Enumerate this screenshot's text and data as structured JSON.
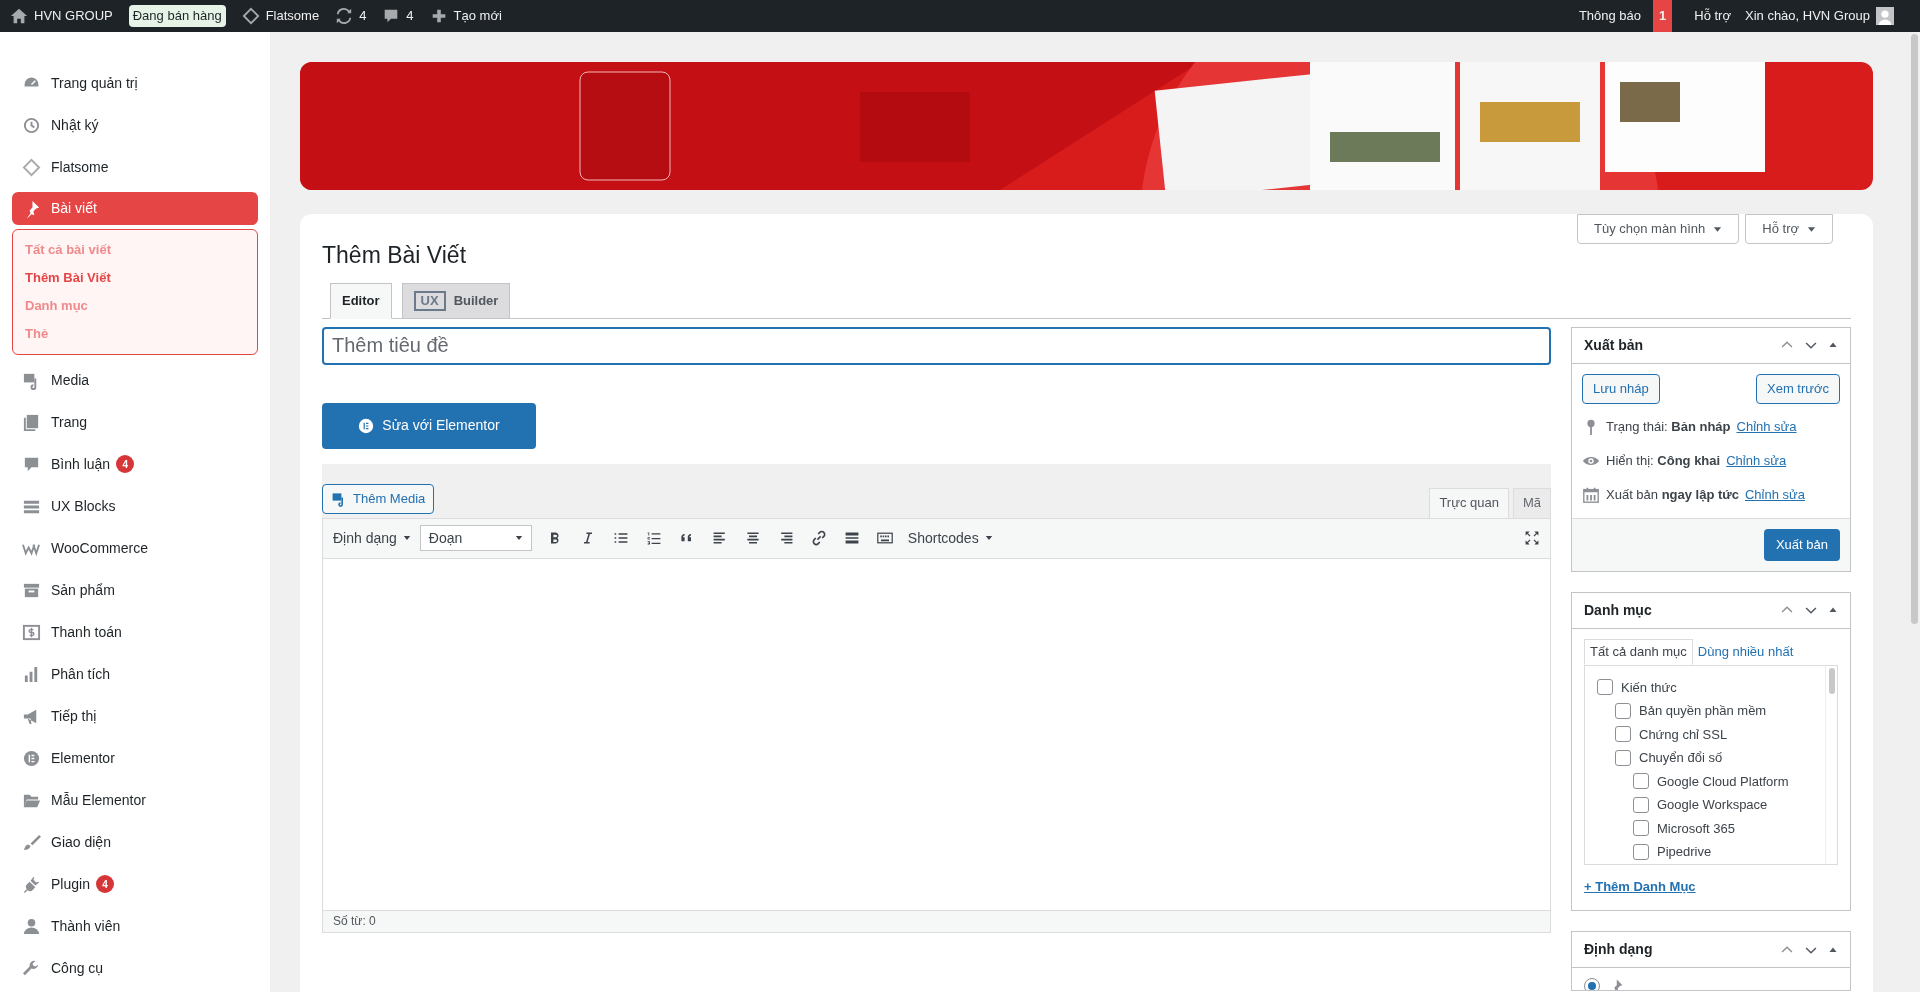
{
  "top_bar": {
    "left": [
      {
        "kind": "home",
        "label": "HVN GROUP"
      },
      {
        "kind": "badge",
        "label": "Đang bán hàng"
      },
      {
        "kind": "theme",
        "label": "Flatsome"
      },
      {
        "kind": "updates",
        "label": "4"
      },
      {
        "kind": "comments",
        "label": "4"
      },
      {
        "kind": "new",
        "label": "Tạo mới"
      }
    ],
    "notifications": {
      "label": "Thông báo",
      "count": "1"
    },
    "help": "Hỗ trợ",
    "greeting": "Xin chào, HVN Group"
  },
  "sidebar": {
    "items": [
      {
        "label": "Trang quản trị",
        "selected": false
      },
      {
        "label": "Nhật ký",
        "selected": false
      },
      {
        "label": "Flatsome",
        "selected": false
      },
      {
        "label": "Bài viết",
        "selected": true,
        "children": [
          {
            "label": "Tất cả bài viết",
            "selected": false
          },
          {
            "label": "Thêm Bài Viết",
            "selected": true
          },
          {
            "label": "Danh mục",
            "selected": false
          },
          {
            "label": "Thẻ",
            "selected": false
          }
        ]
      },
      {
        "label": "Media",
        "selected": false
      },
      {
        "label": "Trang",
        "selected": false
      },
      {
        "label": "Bình luận",
        "badge": "4",
        "selected": false
      },
      {
        "label": "UX Blocks",
        "selected": false
      },
      {
        "label": "WooCommerce",
        "selected": false
      },
      {
        "label": "Sản phẩm",
        "selected": false
      },
      {
        "label": "Thanh toán",
        "selected": false
      },
      {
        "label": "Phân tích",
        "selected": false
      },
      {
        "label": "Tiếp thị",
        "selected": false
      },
      {
        "label": "Elementor",
        "selected": false
      },
      {
        "label": "Mẫu Elementor",
        "selected": false
      },
      {
        "label": "Giao diện",
        "selected": false
      },
      {
        "label": "Plugin",
        "badge": "4",
        "selected": false
      },
      {
        "label": "Thành viên",
        "selected": false
      },
      {
        "label": "Công cụ",
        "selected": false
      }
    ]
  },
  "banner": {
    "kind": "picture"
  },
  "screen_options": [
    "Tùy chọn màn hình",
    "Hỗ trợ"
  ],
  "page_title": "Thêm Bài Viết",
  "editor_tabs": [
    {
      "label": "Editor",
      "selected": true
    },
    {
      "tag": "UX",
      "label": "Builder",
      "selected": false
    }
  ],
  "title_field": {
    "placeholder": "Thêm tiêu đề"
  },
  "elementor_button": "Sửa với Elementor",
  "add_media": "Thêm Media",
  "mode_tabs": [
    {
      "label": "Trực quan",
      "selected": true
    },
    {
      "label": "Mã",
      "selected": false
    }
  ],
  "toolbar": {
    "format_menu": "Định dạng",
    "block_select": "Đoạn",
    "shortcodes": "Shortcodes"
  },
  "word_count": "Số từ: 0",
  "publish_box": {
    "title": "Xuất bản",
    "save_draft": "Lưu nháp",
    "preview": "Xem trước",
    "rows": [
      {
        "text": "Trạng thái: **Bản nháp**",
        "link": "Chỉnh sửa"
      },
      {
        "text": "Hiển thị: **Công khai**",
        "link": "Chỉnh sửa"
      },
      {
        "text": "Xuất bản **ngay lập tức**",
        "link": "Chỉnh sửa"
      }
    ],
    "publish_button": "Xuất bản"
  },
  "categories_box": {
    "title": "Danh mục",
    "tabs": [
      {
        "label": "Tất cả danh mục",
        "selected": true
      },
      {
        "label": "Dùng nhiều nhất",
        "selected": false
      }
    ],
    "tree": [
      {
        "label": "Kiến thức",
        "checked": false,
        "children": [
          {
            "label": "Bản quyền phần mềm",
            "checked": false
          },
          {
            "label": "Chứng chỉ SSL",
            "checked": false
          },
          {
            "label": "Chuyển đổi số",
            "checked": false,
            "children": [
              {
                "label": "Google Cloud Platform",
                "checked": false
              },
              {
                "label": "Google Workspace",
                "checked": false
              },
              {
                "label": "Microsoft 365",
                "checked": false
              },
              {
                "label": "Pipedrive",
                "checked": false
              }
            ]
          }
        ]
      }
    ],
    "add_link": "+ Thêm Danh Mục"
  },
  "format_box": {
    "title": "Định dạng",
    "options": [
      {
        "selected": true
      }
    ]
  }
}
